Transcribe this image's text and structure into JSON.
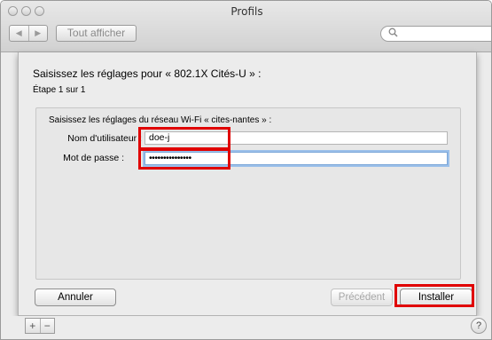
{
  "window": {
    "title": "Profils",
    "show_all_label": "Tout afficher",
    "nav_back_glyph": "◀",
    "nav_forward_glyph": "▶",
    "search_icon": "search-icon"
  },
  "sheet": {
    "heading": "Saisissez les réglages pour « 802.1X Cités-U » :",
    "step": "Étape 1 sur 1",
    "panel_title": "Saisissez les réglages du réseau Wi-Fi « cites-nantes » :",
    "username_label": "Nom d'utilisateur :",
    "username_value": "doe-j",
    "password_label": "Mot de passe :",
    "password_value": "•••••••••••••••",
    "cancel_label": "Annuler",
    "previous_label": "Précédent",
    "install_label": "Installer"
  },
  "bottom_bar": {
    "add_label": "+",
    "remove_label": "−",
    "help_label": "?"
  },
  "colors": {
    "highlight": "#e00000",
    "focus_ring": "#9cc0ea"
  }
}
